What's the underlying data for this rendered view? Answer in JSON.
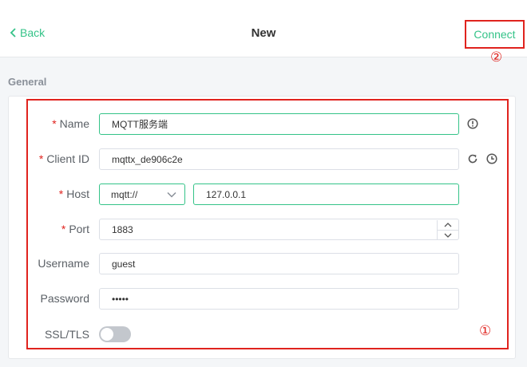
{
  "header": {
    "back_label": "Back",
    "title": "New",
    "connect_label": "Connect"
  },
  "annotations": {
    "marker_1": "①",
    "marker_2": "②"
  },
  "section": {
    "label": "General"
  },
  "form": {
    "required_mark": "*",
    "name": {
      "label": "Name",
      "value": "MQTT服务端",
      "required": true
    },
    "client_id": {
      "label": "Client ID",
      "value": "mqttx_de906c2e",
      "required": true
    },
    "host": {
      "label": "Host",
      "protocol": "mqtt://",
      "value": "127.0.0.1",
      "required": true
    },
    "port": {
      "label": "Port",
      "value": "1883",
      "required": true
    },
    "username": {
      "label": "Username",
      "value": "guest",
      "required": false
    },
    "password": {
      "label": "Password",
      "value": "•••••",
      "required": false
    },
    "ssl_tls": {
      "label": "SSL/TLS",
      "enabled": false
    }
  },
  "icons": {
    "back": "chevron-left-icon",
    "name_info": "info-circle-icon",
    "refresh": "refresh-icon",
    "clock": "clock-icon",
    "protocol_dropdown": "chevron-down-icon",
    "port_up": "chevron-up-icon",
    "port_down": "chevron-down-icon"
  },
  "colors": {
    "accent": "#34c388",
    "annotation_red": "#e0231e",
    "toggle_off": "#c3c7cd"
  }
}
